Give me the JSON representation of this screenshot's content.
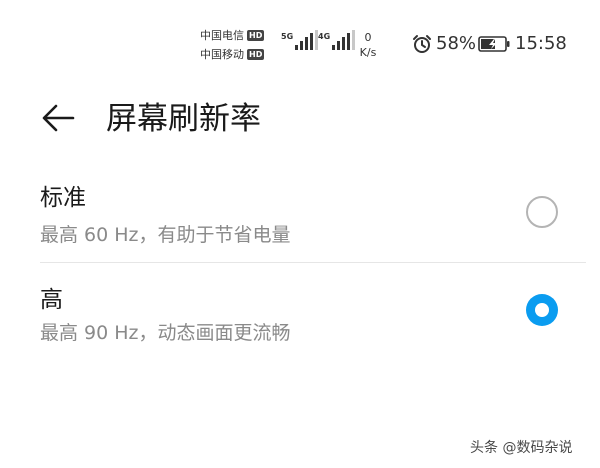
{
  "status_bar": {
    "carriers": [
      {
        "name": "中国电信",
        "badge": "HD"
      },
      {
        "name": "中国移动",
        "badge": "HD"
      }
    ],
    "signals": [
      {
        "type": "5G",
        "level": 4
      },
      {
        "type": "4G",
        "level": 4
      }
    ],
    "net_speed_value": "0",
    "net_speed_unit": "K/s",
    "alarm_icon": "alarm-clock-icon",
    "battery_percent": "58%",
    "battery_icon": "battery-charging-icon",
    "time": "15:58"
  },
  "header": {
    "back_icon": "arrow-left-icon",
    "title": "屏幕刷新率"
  },
  "options": [
    {
      "title": "标准",
      "subtitle": "最高 60 Hz，有助于节省电量",
      "selected": false
    },
    {
      "title": "高",
      "subtitle": "最高 90 Hz，动态画面更流畅",
      "selected": true
    }
  ],
  "watermark": "头条 @数码杂说",
  "colors": {
    "accent": "#0a9cf0",
    "radio_border": "#b4b4b4",
    "subtitle": "#8a8a8a",
    "divider": "#e6e6e6"
  }
}
